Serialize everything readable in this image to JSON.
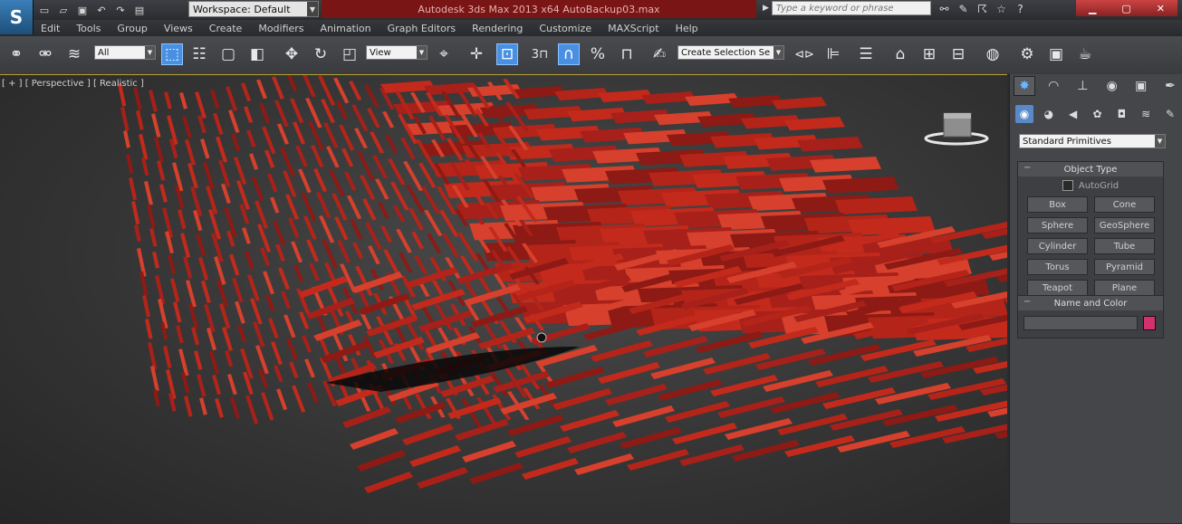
{
  "app": {
    "title": "Autodesk 3ds Max 2013 x64     AutoBackup03.max",
    "logo_glyph": "S"
  },
  "quick_access": {
    "icons": [
      "new-file-icon",
      "open-file-icon",
      "save-file-icon",
      "undo-icon",
      "redo-icon",
      "project-folder-icon"
    ],
    "glyphs": [
      "▭",
      "▱",
      "▣",
      "↶",
      "↷",
      "▤"
    ],
    "workspace_label": "Workspace: Default"
  },
  "search": {
    "placeholder": "Type a keyword or phrase"
  },
  "title_right_icons": {
    "glyphs": [
      "⚯",
      "✎",
      "☈",
      "☆",
      "?"
    ]
  },
  "window_controls": {
    "minimize": "▁",
    "maximize": "▢",
    "close": "✕"
  },
  "menu": {
    "items": [
      "Edit",
      "Tools",
      "Group",
      "Views",
      "Create",
      "Modifiers",
      "Animation",
      "Graph Editors",
      "Rendering",
      "Customize",
      "MAXScript",
      "Help"
    ]
  },
  "toolbar": {
    "selection_filter": "All",
    "reference_coord": "View",
    "named_selection": "Create Selection Se",
    "snap_label": "3",
    "glyphs": {
      "link": "⚭",
      "unlink": "⚮",
      "bind": "≋",
      "select": "⬚",
      "select_by_name": "☷",
      "rect_region": "▢",
      "window_crossing": "◧",
      "move": "✥",
      "rotate": "↻",
      "scale": "◰",
      "select_manipulate": "⌖",
      "pivot": "✛",
      "keyboard_shortcut": "⊡",
      "snap": "⊓",
      "angle_snap": "∩",
      "percent_snap": "%",
      "spinner_snap": "⊓",
      "edit_named": "✍",
      "mirror": "⊲⊳",
      "align": "⊫",
      "layer": "☰",
      "graphite": "⌂",
      "curve_editor": "⊞",
      "schematic": "⊟",
      "material_editor": "◍",
      "render_setup": "⚙",
      "rendered_frame": "▣",
      "render": "☕"
    }
  },
  "viewport": {
    "label": "[ + ] [ Perspective ] [ Realistic ]"
  },
  "command_panel": {
    "tab_glyphs": [
      "✸",
      "◠",
      "⊥",
      "◉",
      "▣",
      "✒"
    ],
    "category_glyphs": [
      "◉",
      "◕",
      "◀",
      "✿",
      "◘",
      "≋",
      "✎"
    ],
    "primitive_type": "Standard Primitives",
    "object_type": {
      "title": "Object Type",
      "autogrid_label": "AutoGrid",
      "buttons": [
        "Box",
        "Cone",
        "Sphere",
        "GeoSphere",
        "Cylinder",
        "Tube",
        "Torus",
        "Pyramid",
        "Teapot",
        "Plane"
      ]
    },
    "name_and_color": {
      "title": "Name and Color",
      "name_value": "",
      "color": "#d4306e"
    }
  },
  "colors": {
    "panel_bg": "#444649",
    "accent_blue": "#4a90e2",
    "object_red": "#b52418",
    "title_red": "#7a1515"
  }
}
